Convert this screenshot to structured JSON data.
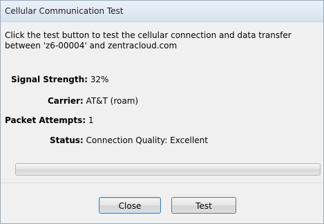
{
  "window": {
    "title": "Cellular Communication Test"
  },
  "instructions": "Click the test button to test the cellular connection and data transfer between 'z6-00004' and zentracloud.com",
  "fields": {
    "signal_strength": {
      "label": "Signal Strength:",
      "value": "32%"
    },
    "carrier": {
      "label": "Carrier:",
      "value": "AT&T (roam)"
    },
    "packet_attempts": {
      "label": "Packet Attempts:",
      "value": "1"
    },
    "status": {
      "label": "Status:",
      "value": "Connection Quality: Excellent"
    }
  },
  "progress": {
    "fraction": 0
  },
  "buttons": {
    "close_label": "Close",
    "test_label": "Test"
  }
}
